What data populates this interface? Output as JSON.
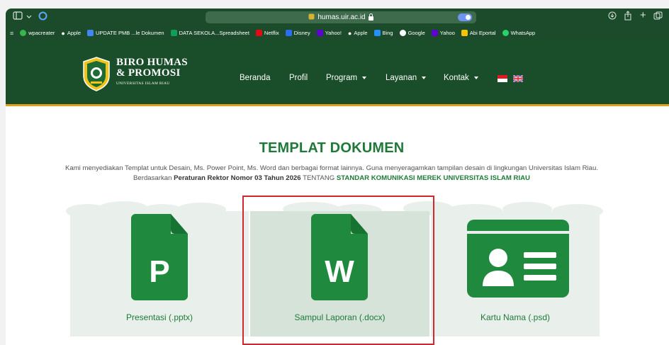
{
  "browser": {
    "url": "humas.uir.ac.id",
    "bookmarks": [
      {
        "label": "wpacreater",
        "color": "#39b54a"
      },
      {
        "label": "Apple",
        "color": "#ffffff"
      },
      {
        "label": "UPDATE PMB ...le Dokumen",
        "color": "#4285f4"
      },
      {
        "label": "DATA SEKOLA...Spreadsheet",
        "color": "#0f9d58"
      },
      {
        "label": "Netflix",
        "color": "#e50914"
      },
      {
        "label": "Disney",
        "color": "#2b6cf2"
      },
      {
        "label": "Yahoo!",
        "color": "#6001d2"
      },
      {
        "label": "Apple",
        "color": "#ffffff"
      },
      {
        "label": "Bing",
        "color": "#258ffa"
      },
      {
        "label": "Google",
        "color": "#ffffff"
      },
      {
        "label": "Yahoo",
        "color": "#6001d2"
      },
      {
        "label": "Abi Eportal",
        "color": "#f5c400"
      },
      {
        "label": "WhatsApp",
        "color": "#25d366"
      }
    ]
  },
  "header": {
    "brand_line1": "BIRO HUMAS",
    "brand_line2": "& PROMOSI",
    "brand_line3": "UNIVERSITAS ISLAM RIAU",
    "nav": [
      {
        "label": "Beranda",
        "dropdown": false
      },
      {
        "label": "Profil",
        "dropdown": false
      },
      {
        "label": "Program",
        "dropdown": true
      },
      {
        "label": "Layanan",
        "dropdown": true
      },
      {
        "label": "Kontak",
        "dropdown": true
      }
    ]
  },
  "main": {
    "title": "TEMPLAT DOKUMEN",
    "desc_part1": "Kami menyediakan Templat untuk Desain, Ms. Power Point, Ms. Word dan berbagai format lainnya. Guna menyeragamkan tampilan desain di lingkungan Universitas Islam Riau. Berdasarkan ",
    "desc_bold": "Peraturan Rektor Nomor 03 Tahun 2026",
    "desc_part2": " TENTANG ",
    "desc_green": "STANDAR KOMUNIKASI MEREK UNIVERSITAS ISLAM RIAU",
    "cards": [
      {
        "label": "Presentasi (.pptx)",
        "icon": "powerpoint-file-icon",
        "letter": "P"
      },
      {
        "label": "Sampul Laporan (.docx)",
        "icon": "word-file-icon",
        "letter": "W"
      },
      {
        "label": "Kartu Nama (.psd)",
        "icon": "id-card-icon"
      }
    ]
  },
  "colors": {
    "header_bg": "#1a4d2a",
    "accent_green": "#1f7a3a",
    "accent_gold": "#e0a21c",
    "highlight_red": "#d3262e"
  }
}
